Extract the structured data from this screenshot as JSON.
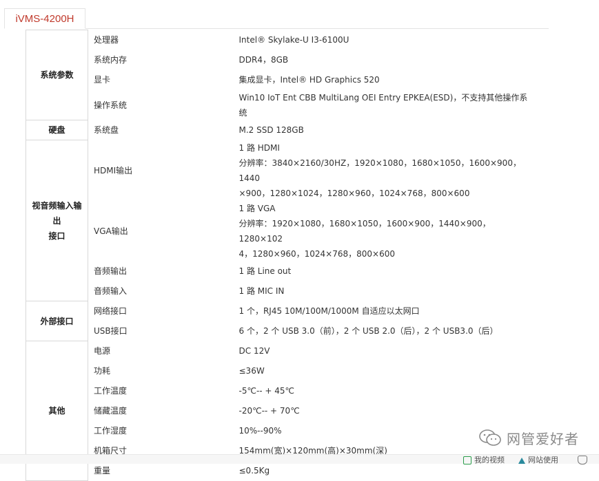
{
  "tab": {
    "title": "iVMS-4200H"
  },
  "sections": [
    {
      "category": "系统参数",
      "rows": [
        {
          "key": "处理器",
          "value": [
            "Intel® Skylake-U I3-6100U"
          ]
        },
        {
          "key": "系统内存",
          "value": [
            "DDR4，8GB"
          ]
        },
        {
          "key": "显卡",
          "value": [
            "集成显卡，Intel® HD Graphics 520"
          ]
        },
        {
          "key": "操作系统",
          "value": [
            "Win10 IoT Ent CBB MultiLang  OEI Entry EPKEA(ESD)，不支持其他操作系",
            "统"
          ]
        }
      ]
    },
    {
      "category": "硬盘",
      "rows": [
        {
          "key": "系统盘",
          "value": [
            "M.2 SSD 128GB"
          ]
        }
      ]
    },
    {
      "category": "视音频输入输出接口",
      "category_lines": [
        "视音频输入输出",
        "接口"
      ],
      "rows": [
        {
          "key": "HDMI输出",
          "value": [
            "1 路 HDMI",
            "分辨率：3840×2160/30HZ，1920×1080，1680×1050，1600×900，1440",
            "×900，1280×1024，1280×960，1024×768，800×600"
          ]
        },
        {
          "key": "VGA输出",
          "value": [
            "1 路 VGA",
            "分辨率：1920×1080，1680×1050，1600×900，1440×900，1280×102",
            "4，1280×960，1024×768，800×600"
          ]
        },
        {
          "key": "音频输出",
          "value": [
            "1 路 Line out"
          ]
        },
        {
          "key": "音频输入",
          "value": [
            "1 路 MIC IN"
          ]
        }
      ]
    },
    {
      "category": "外部接口",
      "rows": [
        {
          "key": "网络接口",
          "value": [
            "1 个，RJ45 10M/100M/1000M 自适应以太网口"
          ]
        },
        {
          "key": "USB接口",
          "value": [
            "6 个，2 个 USB 3.0（前），2 个 USB 2.0（后），2 个 USB3.0（后）"
          ]
        }
      ]
    },
    {
      "category": "其他",
      "rows": [
        {
          "key": "电源",
          "value": [
            "DC 12V"
          ]
        },
        {
          "key": "功耗",
          "value": [
            "≤36W"
          ]
        },
        {
          "key": "工作温度",
          "value": [
            "-5℃-- + 45℃"
          ]
        },
        {
          "key": "储藏温度",
          "value": [
            "-20℃-- + 70℃"
          ]
        },
        {
          "key": "工作湿度",
          "value": [
            "10%--90%"
          ]
        },
        {
          "key": "机箱尺寸",
          "value": [
            "154mm(宽)×120mm(高)×30mm(深)"
          ]
        },
        {
          "key": "重量",
          "value": [
            "≤0.5Kg"
          ]
        }
      ]
    }
  ],
  "watermark": {
    "text": "网管爱好者",
    "icon": "wechat-icon"
  },
  "footer": {
    "item1": "我的视频",
    "item2": "网站使用",
    "item1_icon": "video-icon",
    "item2_icon": "triangle-icon",
    "item3_icon": "shield-icon"
  },
  "colors": {
    "tab_text": "#c0392b",
    "border": "#d8d8d8",
    "text": "#333333"
  }
}
